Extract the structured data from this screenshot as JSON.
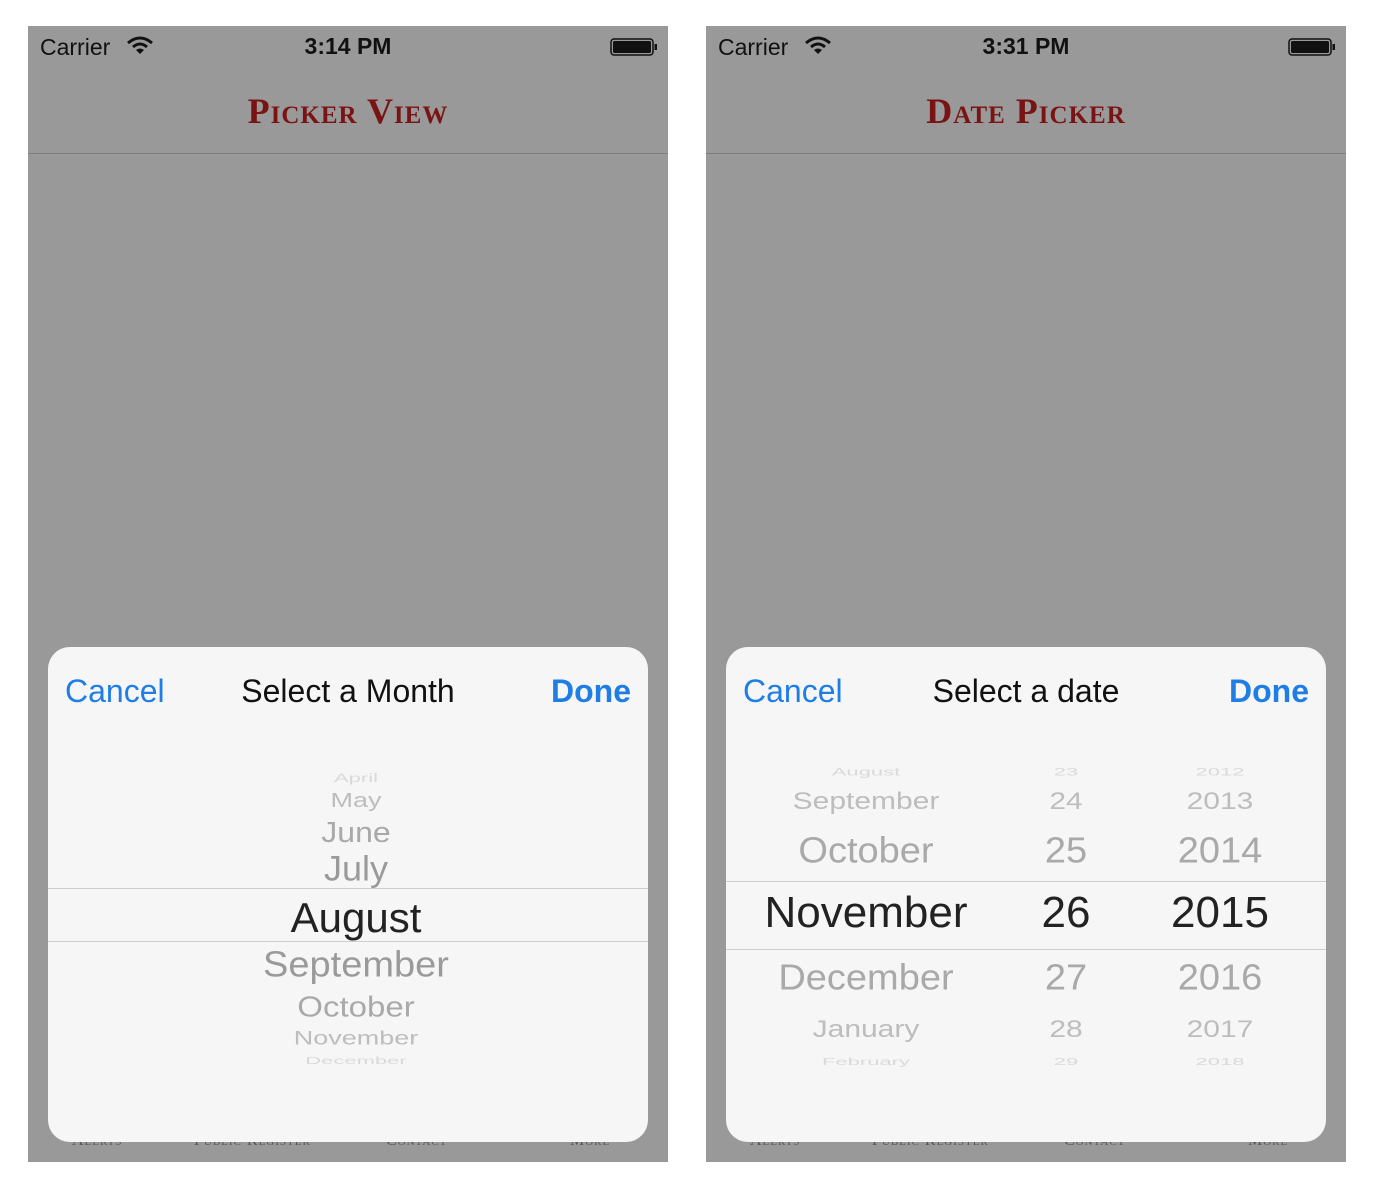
{
  "screens": [
    {
      "status": {
        "carrier": "Carrier",
        "time": "3:14 PM"
      },
      "nav_title": "Picker View",
      "tabs": [
        "Alerts",
        "Public Register",
        "Contact",
        "More"
      ],
      "sheet": {
        "cancel": "Cancel",
        "title": "Select a Month",
        "done": "Done",
        "months": [
          "April",
          "May",
          "June",
          "July",
          "August",
          "September",
          "October",
          "November",
          "December"
        ],
        "selected": "August"
      }
    },
    {
      "status": {
        "carrier": "Carrier",
        "time": "3:31 PM"
      },
      "nav_title": "Date Picker",
      "tabs": [
        "Alerts",
        "Public Register",
        "Contact",
        "More"
      ],
      "sheet": {
        "cancel": "Cancel",
        "title": "Select a date",
        "done": "Done",
        "months": [
          "August",
          "September",
          "October",
          "November",
          "December",
          "January",
          "February"
        ],
        "days": [
          "23",
          "24",
          "25",
          "26",
          "27",
          "28",
          "29"
        ],
        "years": [
          "2012",
          "2013",
          "2014",
          "2015",
          "2016",
          "2017",
          "2018"
        ],
        "selected": {
          "month": "November",
          "day": "26",
          "year": "2015"
        }
      }
    }
  ],
  "colors": {
    "background": "#999999",
    "title_red": "#7a1414",
    "ios_blue": "#1f7de6",
    "sheet": "#f6f6f6"
  }
}
